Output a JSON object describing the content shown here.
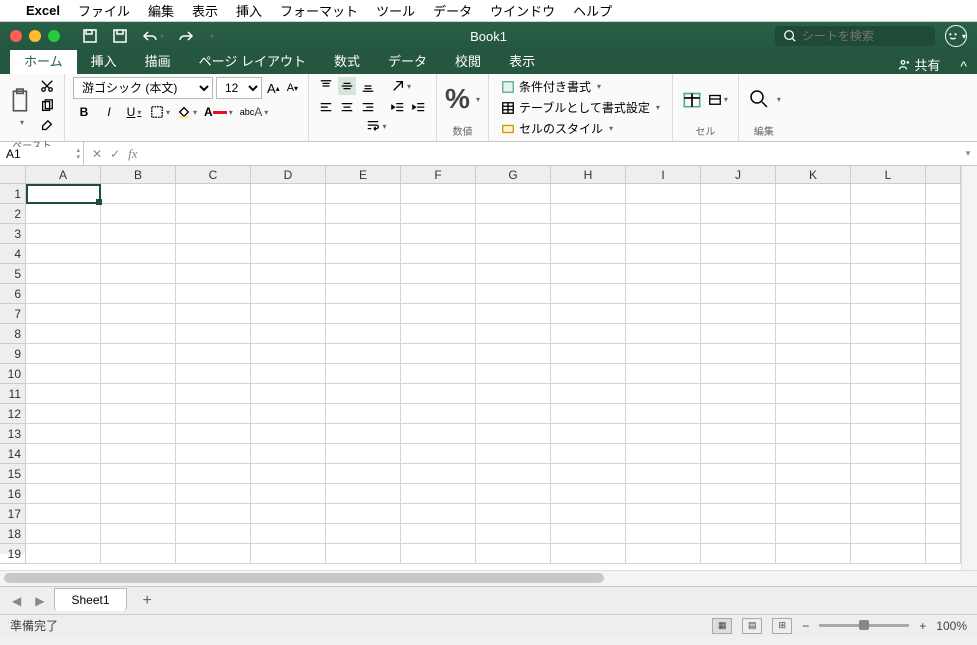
{
  "mac_menu": {
    "app": "Excel",
    "items": [
      "ファイル",
      "編集",
      "表示",
      "挿入",
      "フォーマット",
      "ツール",
      "データ",
      "ウインドウ",
      "ヘルプ"
    ]
  },
  "titlebar": {
    "doc": "Book1",
    "search_placeholder": "シートを検索"
  },
  "ribbon_tabs": {
    "tabs": [
      "ホーム",
      "挿入",
      "描画",
      "ページ レイアウト",
      "数式",
      "データ",
      "校閲",
      "表示"
    ],
    "active": 0,
    "share": "共有"
  },
  "ribbon": {
    "clipboard": {
      "label": "ペースト"
    },
    "font": {
      "name": "游ゴシック (本文)",
      "size": "12"
    },
    "number": {
      "label": "数値"
    },
    "styles": {
      "cond": "条件付き書式",
      "table": "テーブルとして書式設定",
      "cell": "セルのスタイル"
    },
    "cells": {
      "label": "セル"
    },
    "editing": {
      "label": "編集"
    }
  },
  "formula_bar": {
    "name_box": "A1",
    "fx": "fx"
  },
  "grid": {
    "columns": [
      "A",
      "B",
      "C",
      "D",
      "E",
      "F",
      "G",
      "H",
      "I",
      "J",
      "K",
      "L"
    ],
    "row_count": 19
  },
  "sheets": {
    "active": "Sheet1"
  },
  "status": {
    "ready": "準備完了",
    "zoom": "100%"
  }
}
